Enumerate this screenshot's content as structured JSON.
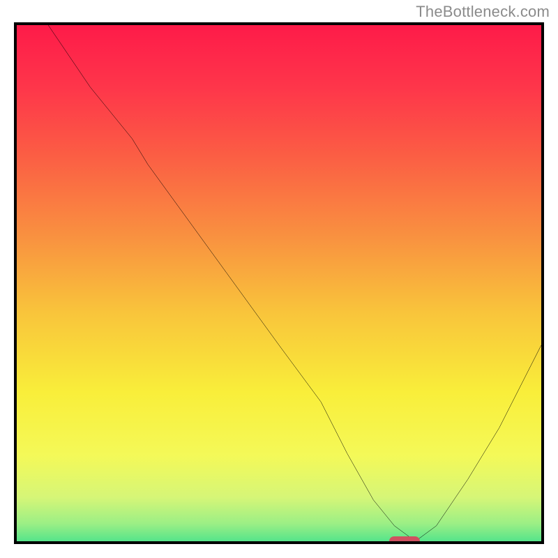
{
  "watermark": "TheBottleneck.com",
  "colors": {
    "frame_border": "#000000",
    "marker_fill": "#cf5160",
    "curve_stroke": "#000000",
    "gradient_stops": [
      {
        "offset": 0.0,
        "color": "#fe1b49"
      },
      {
        "offset": 0.12,
        "color": "#fe364a"
      },
      {
        "offset": 0.25,
        "color": "#fb5e44"
      },
      {
        "offset": 0.4,
        "color": "#f99040"
      },
      {
        "offset": 0.55,
        "color": "#f9c53b"
      },
      {
        "offset": 0.7,
        "color": "#f9ee3a"
      },
      {
        "offset": 0.82,
        "color": "#f4f958"
      },
      {
        "offset": 0.9,
        "color": "#d6f677"
      },
      {
        "offset": 0.95,
        "color": "#9cef85"
      },
      {
        "offset": 1.0,
        "color": "#34df8d"
      }
    ]
  },
  "chart_data": {
    "type": "line",
    "title": "",
    "xlabel": "",
    "ylabel": "",
    "xlim": [
      0,
      100
    ],
    "ylim": [
      0,
      100
    ],
    "x": [
      0,
      6,
      14,
      22,
      25,
      30,
      40,
      50,
      58,
      63,
      68,
      72,
      76,
      80,
      86,
      92,
      100
    ],
    "values": [
      108,
      100,
      88,
      78,
      73,
      66,
      52,
      38,
      27,
      17,
      8,
      3,
      0,
      3,
      12,
      22,
      38
    ],
    "marker": {
      "x": 74,
      "y": 0
    },
    "description": "V-shaped bottleneck curve over vertical red-to-green gradient; minimum near x≈74 at y=0."
  }
}
